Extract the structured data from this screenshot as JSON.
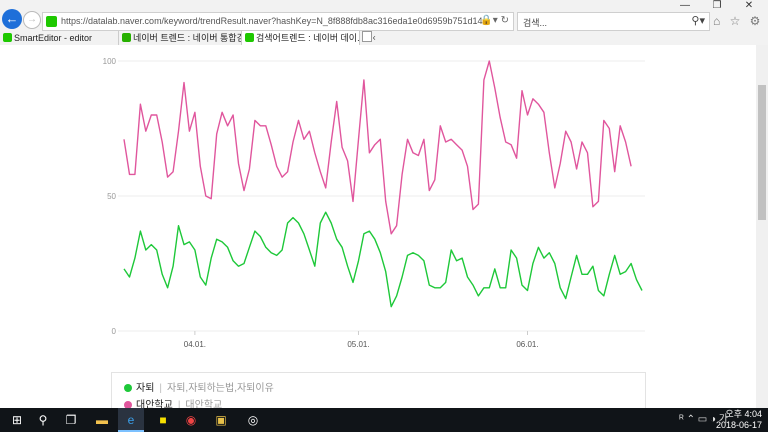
{
  "browser": {
    "url": "https://datalab.naver.com/keyword/trendResult.naver?hashKey=N_8f888fdb8ac316eda1e0d6959b751d14",
    "search_placeholder": "검색...",
    "window_controls": {
      "minimize": "—",
      "maximize": "❐",
      "close": "✕"
    },
    "tool_icons": "⌂ ☆ ⚙ ☺"
  },
  "favorites": [
    {
      "label": "SmartEditor - editor"
    }
  ],
  "tabs": [
    {
      "label": "네이버 트렌드 : 네이버 통합검색",
      "active": false
    },
    {
      "label": "검색어트렌드 : 네이버 데이...",
      "active": true
    }
  ],
  "chart_data": {
    "type": "line",
    "y_ticks": [
      "100",
      "50",
      "0"
    ],
    "ylim": [
      0,
      100
    ],
    "x_ticks": [
      {
        "label": "04.01.",
        "index": 13
      },
      {
        "label": "05.01.",
        "index": 43
      },
      {
        "label": "06.01.",
        "index": 74
      }
    ],
    "colors": {
      "series1": "#1ec839",
      "series2": "#e0569d"
    },
    "series": [
      {
        "name": "자퇴",
        "values": [
          23,
          20,
          27,
          37,
          30,
          32,
          30,
          21,
          16,
          24,
          39,
          32,
          33,
          30,
          20,
          17,
          27,
          34,
          33,
          31,
          26,
          24,
          25,
          31,
          37,
          35,
          31,
          29,
          28,
          30,
          40,
          42,
          40,
          36,
          30,
          24,
          40,
          44,
          40,
          34,
          31,
          24,
          18,
          26,
          36,
          37,
          34,
          29,
          22,
          9,
          13,
          20,
          28,
          29,
          28,
          26,
          17,
          16,
          16,
          18,
          30,
          26,
          27,
          20,
          17,
          13,
          16,
          16,
          23,
          16,
          16,
          30,
          27,
          17,
          15,
          25,
          31,
          27,
          29,
          25,
          16,
          12,
          20,
          28,
          21,
          21,
          24,
          15,
          13,
          21,
          28,
          21,
          22,
          25,
          19,
          15
        ]
      },
      {
        "name": "대안학교",
        "values": [
          71,
          58,
          58,
          84,
          74,
          80,
          80,
          70,
          57,
          59,
          74,
          92,
          74,
          81,
          61,
          50,
          49,
          73,
          81,
          76,
          80,
          62,
          52,
          60,
          78,
          76,
          76,
          69,
          61,
          57,
          59,
          70,
          78,
          71,
          74,
          66,
          59,
          53,
          70,
          85,
          68,
          63,
          48,
          71,
          93,
          66,
          69,
          71,
          48,
          36,
          39,
          58,
          71,
          66,
          65,
          71,
          52,
          56,
          76,
          70,
          71,
          69,
          67,
          61,
          45,
          47,
          93,
          100,
          90,
          79,
          70,
          69,
          64,
          89,
          80,
          86,
          84,
          81,
          66,
          53,
          62,
          74,
          70,
          60,
          70,
          66,
          46,
          48,
          78,
          75,
          59,
          76,
          70,
          61
        ]
      }
    ],
    "legend": [
      {
        "name": "자퇴",
        "terms": "자퇴,자퇴하는법,자퇴이유"
      },
      {
        "name": "대안학교",
        "terms": "대안학교"
      }
    ]
  },
  "taskbar": {
    "icons": [
      "windows-start",
      "search",
      "task-view",
      "file-explorer",
      "edge",
      "kakaotalk",
      "chrome",
      "photo",
      "app-circle"
    ],
    "tray": "ᴿ ⌃ ▭ ◑ 가",
    "time": "오후 4:04",
    "date": "2018-06-17"
  }
}
